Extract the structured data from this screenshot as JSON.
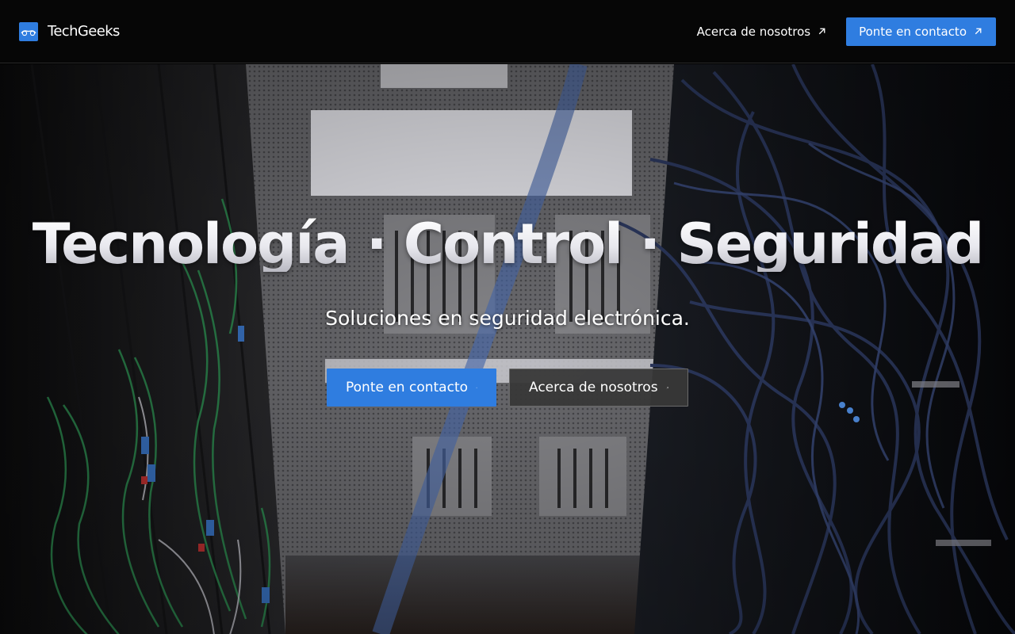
{
  "header": {
    "brand": "TechGeeks",
    "nav": {
      "about_label": "Acerca de nosotros",
      "contact_label": "Ponte en contacto"
    }
  },
  "hero": {
    "title": "Tecnología · Control · Seguridad",
    "subtitle": "Soluciones en seguridad electrónica.",
    "primary_button_label": "Ponte en contacto",
    "secondary_button_label": "Acerca de nosotros"
  },
  "icons": {
    "logo": "glasses-logo-icon",
    "link_arrow": "arrow-up-right-icon"
  },
  "colors": {
    "accent": "#2f7de0",
    "header_bg": "#060606",
    "secondary_button_bg": "#383838"
  }
}
